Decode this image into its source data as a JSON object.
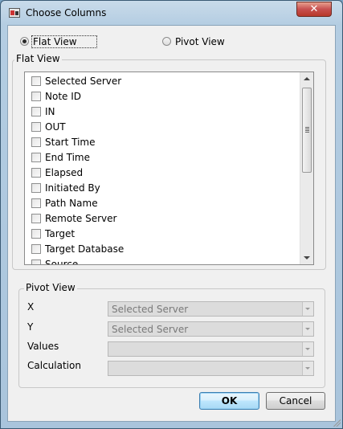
{
  "window": {
    "title": "Choose Columns",
    "close_label": "✕"
  },
  "view_mode": {
    "flat_label": "Flat View",
    "pivot_label": "Pivot View",
    "selected": "flat"
  },
  "flat_group": {
    "title": "Flat View",
    "columns": [
      {
        "label": "Selected Server",
        "checked": false
      },
      {
        "label": "Note ID",
        "checked": false
      },
      {
        "label": "IN",
        "checked": false
      },
      {
        "label": "OUT",
        "checked": false
      },
      {
        "label": "Start Time",
        "checked": false
      },
      {
        "label": "End Time",
        "checked": false
      },
      {
        "label": "Elapsed",
        "checked": false
      },
      {
        "label": "Initiated By",
        "checked": false
      },
      {
        "label": "Path Name",
        "checked": false
      },
      {
        "label": "Remote Server",
        "checked": false
      },
      {
        "label": "Target",
        "checked": false
      },
      {
        "label": "Target Database",
        "checked": false
      },
      {
        "label": "Source",
        "checked": false
      }
    ]
  },
  "pivot_group": {
    "title": "Pivot View",
    "x_label": "X",
    "x_value": "Selected Server",
    "y_label": "Y",
    "y_value": "Selected Server",
    "values_label": "Values",
    "values_value": "",
    "calc_label": "Calculation",
    "calc_value": ""
  },
  "buttons": {
    "ok": "OK",
    "cancel": "Cancel"
  }
}
